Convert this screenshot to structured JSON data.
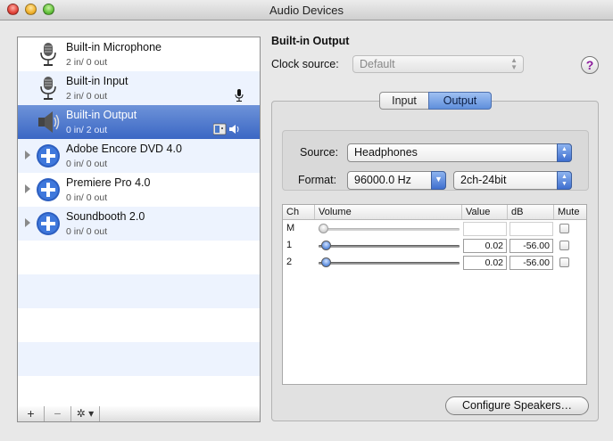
{
  "window": {
    "title": "Audio Devices"
  },
  "devices": [
    {
      "name": "Built-in Microphone",
      "io": "2 in/ 0 out",
      "icon": "microphone-icon",
      "selected": false
    },
    {
      "name": "Built-in Input",
      "io": "2 in/ 0 out",
      "icon": "microphone-icon",
      "selected": false
    },
    {
      "name": "Built-in Output",
      "io": "0 in/ 2 out",
      "icon": "speaker-icon",
      "selected": true
    },
    {
      "name": "Adobe Encore DVD 4.0",
      "io": "0 in/ 0 out",
      "icon": "plus-icon",
      "selected": false
    },
    {
      "name": "Premiere Pro 4.0",
      "io": "0 in/ 0 out",
      "icon": "plus-icon",
      "selected": false
    },
    {
      "name": "Soundbooth 2.0",
      "io": "0 in/ 0 out",
      "icon": "plus-icon",
      "selected": false
    }
  ],
  "list_buttons": {
    "add": "+",
    "remove": "−",
    "gear": "✲ ▾"
  },
  "detail": {
    "title": "Built-in Output",
    "clock_label": "Clock source:",
    "clock_value": "Default",
    "help": "?"
  },
  "tabs": {
    "input": "Input",
    "output": "Output",
    "active": "output"
  },
  "source": {
    "label": "Source:",
    "value": "Headphones"
  },
  "format": {
    "label": "Format:",
    "rate": "96000.0 Hz",
    "channels": "2ch-24bit"
  },
  "channel_table": {
    "headers": {
      "ch": "Ch",
      "volume": "Volume",
      "value": "Value",
      "db": "dB",
      "mute": "Mute"
    },
    "rows": [
      {
        "ch": "M",
        "volume": 0.0,
        "value": "",
        "db": "",
        "enabled": false
      },
      {
        "ch": "1",
        "volume": 0.02,
        "value": "0.02",
        "db": "-56.00",
        "enabled": true
      },
      {
        "ch": "2",
        "volume": 0.02,
        "value": "0.02",
        "db": "-56.00",
        "enabled": true
      }
    ]
  },
  "configure_button": "Configure Speakers…"
}
